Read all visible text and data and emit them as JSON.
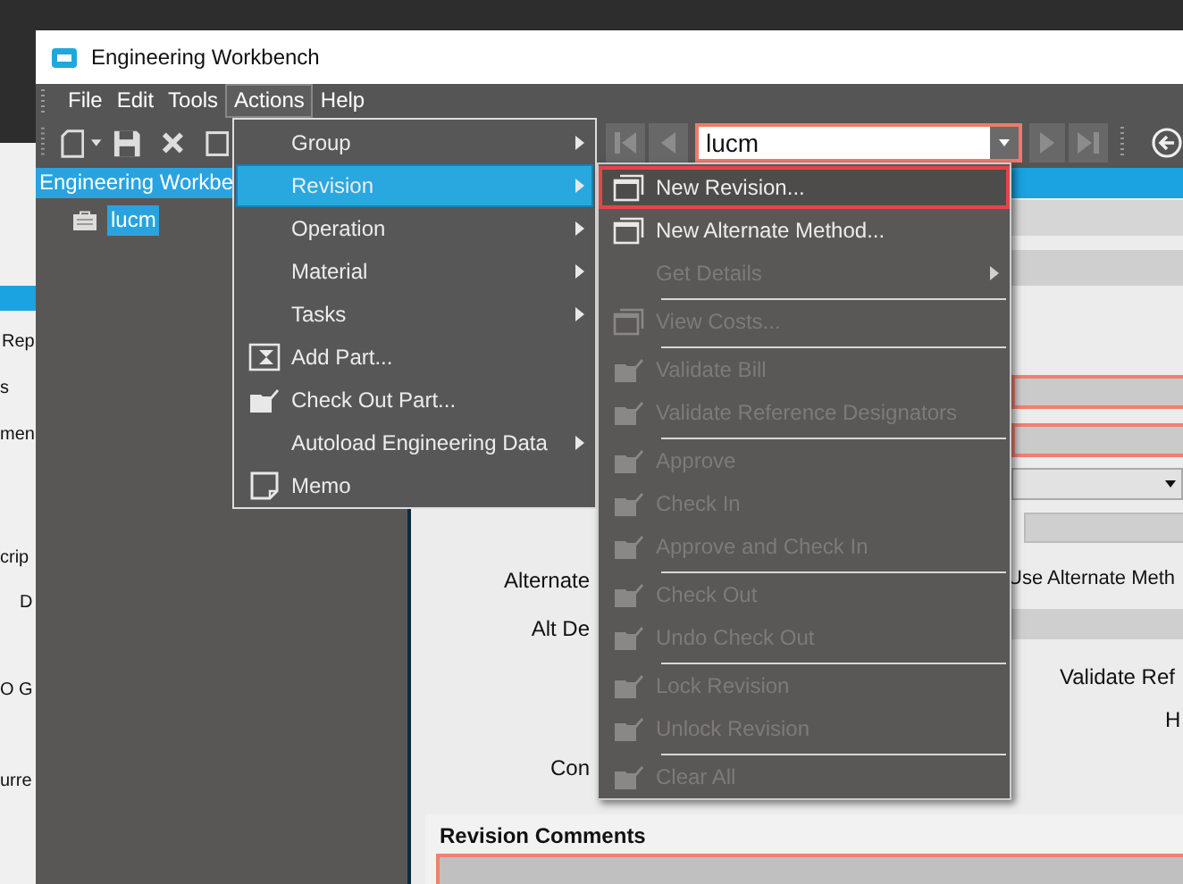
{
  "window": {
    "title": "Engineering Workbench"
  },
  "menu_bar": [
    {
      "label": "File",
      "selected": false
    },
    {
      "label": "Edit",
      "selected": false
    },
    {
      "label": "Tools",
      "selected": false
    },
    {
      "label": "Actions",
      "selected": true
    },
    {
      "label": "Help",
      "selected": false
    }
  ],
  "navigator": {
    "value": "lucm"
  },
  "tree": {
    "header": "Engineering Workbe",
    "items": [
      {
        "label": "lucm",
        "selected": true
      }
    ]
  },
  "actions_menu": [
    {
      "label": "Group",
      "kind": "plain",
      "has_submenu": true,
      "selected": false
    },
    {
      "label": "Revision",
      "kind": "plain",
      "has_submenu": true,
      "selected": true
    },
    {
      "label": "Operation",
      "kind": "plain",
      "has_submenu": true,
      "selected": false
    },
    {
      "label": "Material",
      "kind": "plain",
      "has_submenu": true,
      "selected": false
    },
    {
      "label": "Tasks",
      "kind": "plain",
      "has_submenu": true,
      "selected": false
    },
    {
      "label": "Add Part...",
      "kind": "add",
      "has_submenu": false,
      "selected": false
    },
    {
      "label": "Check Out Part...",
      "kind": "checkout",
      "has_submenu": false,
      "selected": false
    },
    {
      "label": "Autoload Engineering Data",
      "kind": "plain",
      "has_submenu": true,
      "selected": false
    },
    {
      "label": "Memo",
      "kind": "memo",
      "has_submenu": false,
      "selected": false
    }
  ],
  "revision_submenu": [
    {
      "label": "New Revision...",
      "kind": "dialog",
      "disabled": false,
      "selected": true,
      "has_submenu": false,
      "separator_before": false
    },
    {
      "label": "New Alternate Method...",
      "kind": "dialog",
      "disabled": false,
      "selected": false,
      "has_submenu": false,
      "separator_before": false
    },
    {
      "label": "Get Details",
      "kind": "plain",
      "disabled": true,
      "selected": false,
      "has_submenu": true,
      "separator_before": false
    },
    {
      "label": "View Costs...",
      "kind": "dialog",
      "disabled": true,
      "selected": false,
      "has_submenu": false,
      "separator_before": true
    },
    {
      "label": "Validate Bill",
      "kind": "checkout",
      "disabled": true,
      "selected": false,
      "has_submenu": false,
      "separator_before": true
    },
    {
      "label": "Validate Reference Designators",
      "kind": "checkout",
      "disabled": true,
      "selected": false,
      "has_submenu": false,
      "separator_before": false
    },
    {
      "label": "Approve",
      "kind": "checkout",
      "disabled": true,
      "selected": false,
      "has_submenu": false,
      "separator_before": true
    },
    {
      "label": "Check In",
      "kind": "checkout",
      "disabled": true,
      "selected": false,
      "has_submenu": false,
      "separator_before": false
    },
    {
      "label": "Approve and Check In",
      "kind": "checkout",
      "disabled": true,
      "selected": false,
      "has_submenu": false,
      "separator_before": false
    },
    {
      "label": "Check Out",
      "kind": "checkout",
      "disabled": true,
      "selected": false,
      "has_submenu": false,
      "separator_before": true
    },
    {
      "label": "Undo Check Out",
      "kind": "checkout",
      "disabled": true,
      "selected": false,
      "has_submenu": false,
      "separator_before": false
    },
    {
      "label": "Lock Revision",
      "kind": "checkout",
      "disabled": true,
      "selected": false,
      "has_submenu": false,
      "separator_before": true
    },
    {
      "label": "Unlock Revision",
      "kind": "checkout",
      "disabled": true,
      "selected": false,
      "has_submenu": false,
      "separator_before": false
    },
    {
      "label": "Clear All",
      "kind": "checkout",
      "disabled": true,
      "selected": false,
      "has_submenu": false,
      "separator_before": true
    }
  ],
  "form": {
    "labels": [
      "Alternate",
      "Alt De",
      "Con",
      "Use Alternate Meth",
      "Validate Ref",
      "H"
    ],
    "comments_label": "Revision Comments"
  },
  "background_window": {
    "texts": [
      "Rep",
      "s",
      "men",
      "crip",
      "D",
      "O G",
      "urre"
    ]
  }
}
